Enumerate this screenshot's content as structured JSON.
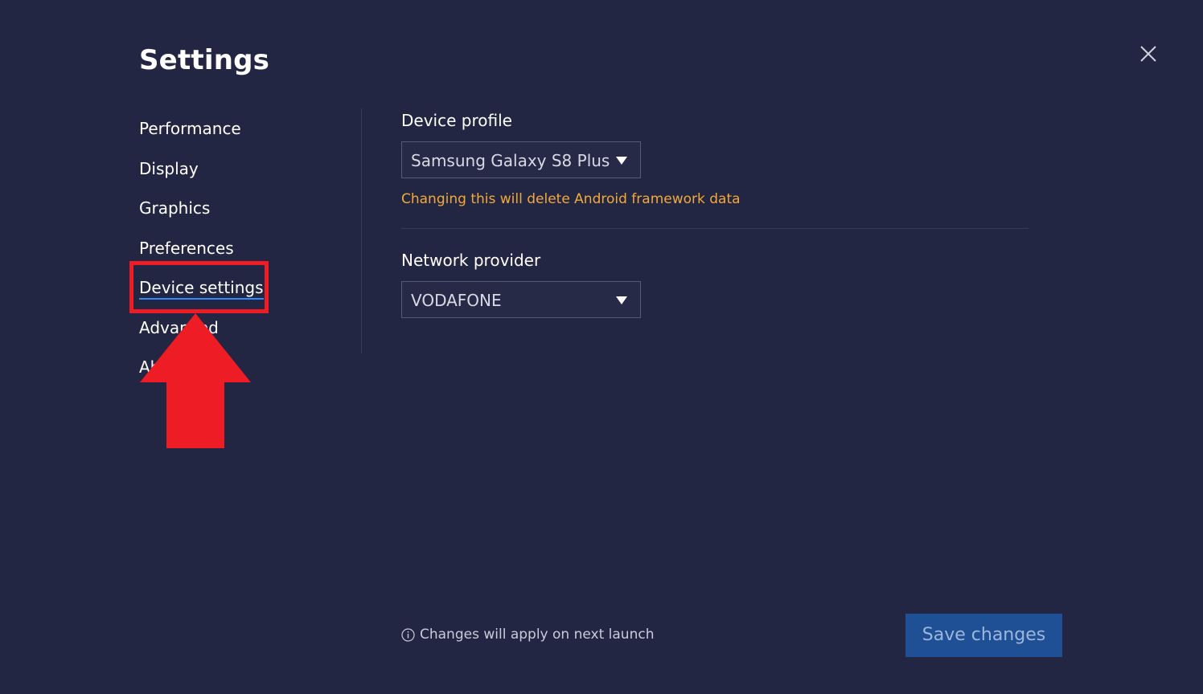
{
  "header": {
    "title": "Settings"
  },
  "nav": {
    "items": [
      {
        "label": "Performance",
        "active": false
      },
      {
        "label": "Display",
        "active": false
      },
      {
        "label": "Graphics",
        "active": false
      },
      {
        "label": "Preferences",
        "active": false
      },
      {
        "label": "Device settings",
        "active": true
      },
      {
        "label": "Advanced",
        "active": false
      },
      {
        "label": "About",
        "active": false
      }
    ]
  },
  "device_profile": {
    "label": "Device profile",
    "selected": "Samsung Galaxy S8 Plus",
    "warning": "Changing this will delete Android framework data"
  },
  "network_provider": {
    "label": "Network provider",
    "selected": "VODAFONE"
  },
  "footer": {
    "note": "Changes will apply on next launch",
    "save_label": "Save changes"
  },
  "colors": {
    "background": "#232642",
    "accent": "#2f8cff",
    "warning": "#f2a93b",
    "save_button": "#1f4f94",
    "annotation": "#ee1c24"
  },
  "icons": {
    "close": "close-icon",
    "info": "info-icon",
    "dropdown": "chevron-down-icon"
  }
}
